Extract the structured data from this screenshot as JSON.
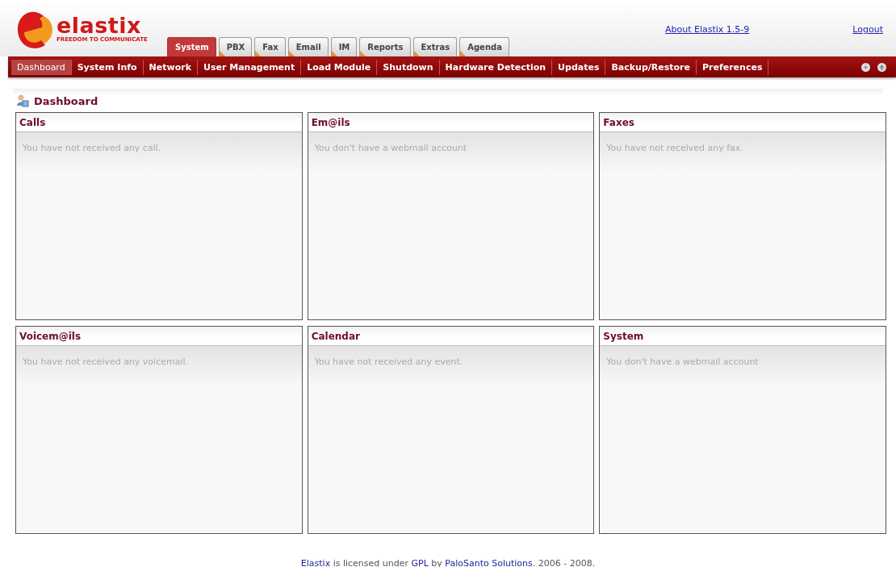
{
  "logo": {
    "name": "elastix",
    "tagline": "FREEDOM TO COMMUNICATE"
  },
  "tabs": [
    {
      "label": "System",
      "selected": true
    },
    {
      "label": "PBX",
      "selected": false
    },
    {
      "label": "Fax",
      "selected": false
    },
    {
      "label": "Email",
      "selected": false
    },
    {
      "label": "IM",
      "selected": false
    },
    {
      "label": "Reports",
      "selected": false
    },
    {
      "label": "Extras",
      "selected": false
    },
    {
      "label": "Agenda",
      "selected": false
    }
  ],
  "header_links": [
    "About Elastix 1.5-9",
    "Logout"
  ],
  "menu": [
    {
      "label": "Dashboard",
      "selected": true
    },
    {
      "label": "System Info",
      "selected": false
    },
    {
      "label": "Network",
      "selected": false
    },
    {
      "label": "User Management",
      "selected": false
    },
    {
      "label": "Load Module",
      "selected": false
    },
    {
      "label": "Shutdown",
      "selected": false
    },
    {
      "label": "Hardware Detection",
      "selected": false
    },
    {
      "label": "Updates",
      "selected": false
    },
    {
      "label": "Backup/Restore",
      "selected": false
    },
    {
      "label": "Preferences",
      "selected": false
    }
  ],
  "page_title": "Dashboard",
  "panels": [
    {
      "title": "Calls",
      "message": "You have not received any call."
    },
    {
      "title": "Em@ils",
      "message": "You don't have a webmail account"
    },
    {
      "title": "Faxes",
      "message": "You have not received any fax."
    },
    {
      "title": "Voicem@ils",
      "message": "You have not received any voicemail."
    },
    {
      "title": "Calendar",
      "message": "You have not received any event."
    },
    {
      "title": "System",
      "message": "You don't have a webmail account"
    }
  ],
  "footer": [
    {
      "text": "Elastix",
      "link": true
    },
    {
      "text": " is licensed under ",
      "link": false
    },
    {
      "text": "GPL",
      "link": true
    },
    {
      "text": " by ",
      "link": false
    },
    {
      "text": "PaloSanto Solutions",
      "link": true
    },
    {
      "text": ". 2006 - 2008.",
      "link": false
    }
  ]
}
